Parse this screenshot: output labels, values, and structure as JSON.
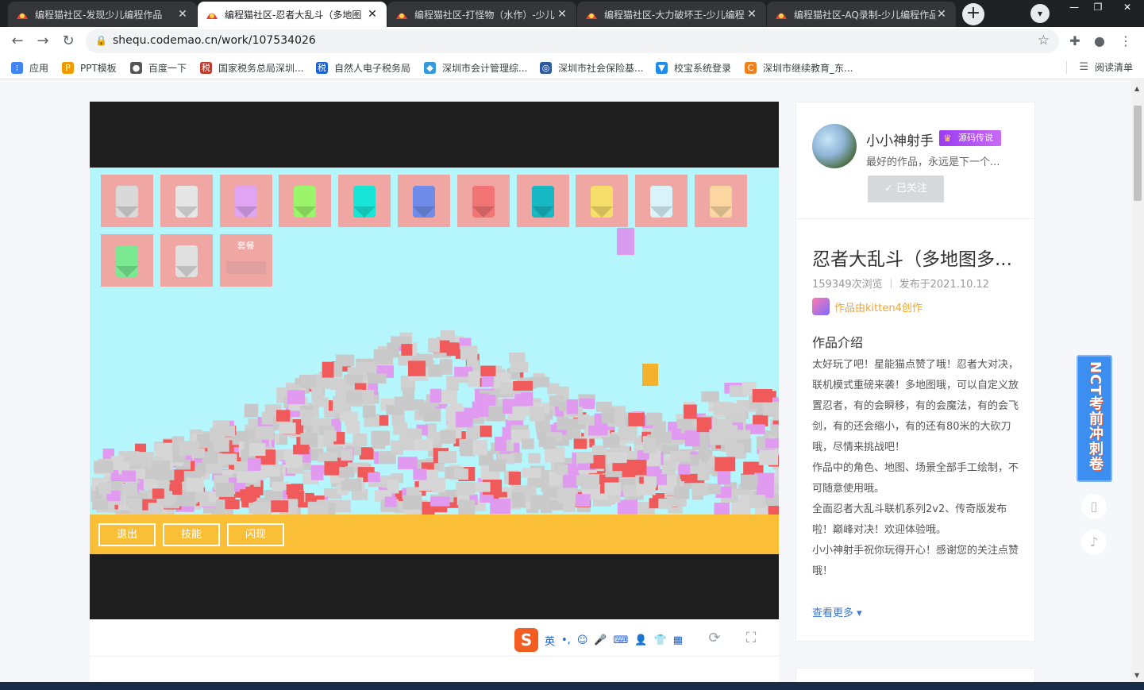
{
  "browser": {
    "tabs": [
      {
        "title": "编程猫社区-发现少儿编程作品",
        "active": false
      },
      {
        "title": "编程猫社区-忍者大乱斗（多地图",
        "active": true
      },
      {
        "title": "编程猫社区-打怪物（水作）-少儿",
        "active": false
      },
      {
        "title": "编程猫社区-大力破坏王-少儿编程",
        "active": false
      },
      {
        "title": "编程猫社区-AQ录制-少儿编程作品",
        "active": false
      }
    ],
    "new_tab": "+",
    "url": "shequ.codemao.cn/work/107534026",
    "bookmarks": [
      {
        "label": "应用",
        "color": "#4285f4",
        "glyph": "⁝"
      },
      {
        "label": "PPT模板",
        "color": "#f29900",
        "glyph": "P"
      },
      {
        "label": "百度一下",
        "color": "#555555",
        "glyph": "●"
      },
      {
        "label": "国家税务总局深圳...",
        "color": "#c0392b",
        "glyph": "税"
      },
      {
        "label": "自然人电子税务局",
        "color": "#1a5fd3",
        "glyph": "税"
      },
      {
        "label": "深圳市会计管理综...",
        "color": "#3498db",
        "glyph": "◆"
      },
      {
        "label": "深圳市社会保险基...",
        "color": "#2c5aa0",
        "glyph": "◎"
      },
      {
        "label": "校宝系统登录",
        "color": "#1f8be8",
        "glyph": "▼"
      },
      {
        "label": "深圳市继续教育_东...",
        "color": "#f0821e",
        "glyph": "C"
      }
    ],
    "reading_list": "阅读清单"
  },
  "game": {
    "buttons": [
      "退出",
      "技能",
      "闪现"
    ],
    "combo_label": "套餐",
    "ninja_colors_row1": [
      "#d9d9d9",
      "#e6e6e6",
      "#e0a4f2",
      "#9af56a",
      "#17e6d6",
      "#6f8de8",
      "#f27474",
      "#17b8c4",
      "#f7dd6a",
      "#d8f3fa",
      "#fbd6a0"
    ],
    "ninja_colors_row2": [
      "#7be892",
      "#e0e0e0"
    ]
  },
  "ime": {
    "logo": "S",
    "items": [
      "英",
      "•,",
      "☺",
      "🎤",
      "⌨",
      "👤",
      "👕",
      "▦"
    ]
  },
  "author": {
    "name": "小小神射手",
    "badge": "源码传说",
    "motto": "最好的作品，永远是下一个...",
    "follow_label": "✓ 已关注"
  },
  "work": {
    "title": "忍者大乱斗（多地图多...",
    "views": "159349次浏览",
    "published": "发布于2021.10.12",
    "created_with": "作品由kitten4创作",
    "intro_heading": "作品介绍",
    "intro_lines": [
      "太好玩了吧！星能猫点赞了哦！忍者大对决，联机模式重磅来袭！多地图哦，可以自定义放置忍者，有的会瞬移，有的会魔法，有的会飞剑，有的还会缩小，有的还有80米的大砍刀哦，尽情来挑战吧！",
      "作品中的角色、地图、场景全部手工绘制，不可随意使用哦。",
      "全面忍者大乱斗联机系列2v2、传奇版发布啦！巅峰对决！欢迎体验哦。",
      "小小神射手祝你玩得开心！感谢您的关注点赞哦！"
    ],
    "more_label": "查看更多 ▾"
  },
  "float_ad": "NCT考前冲刺卷"
}
